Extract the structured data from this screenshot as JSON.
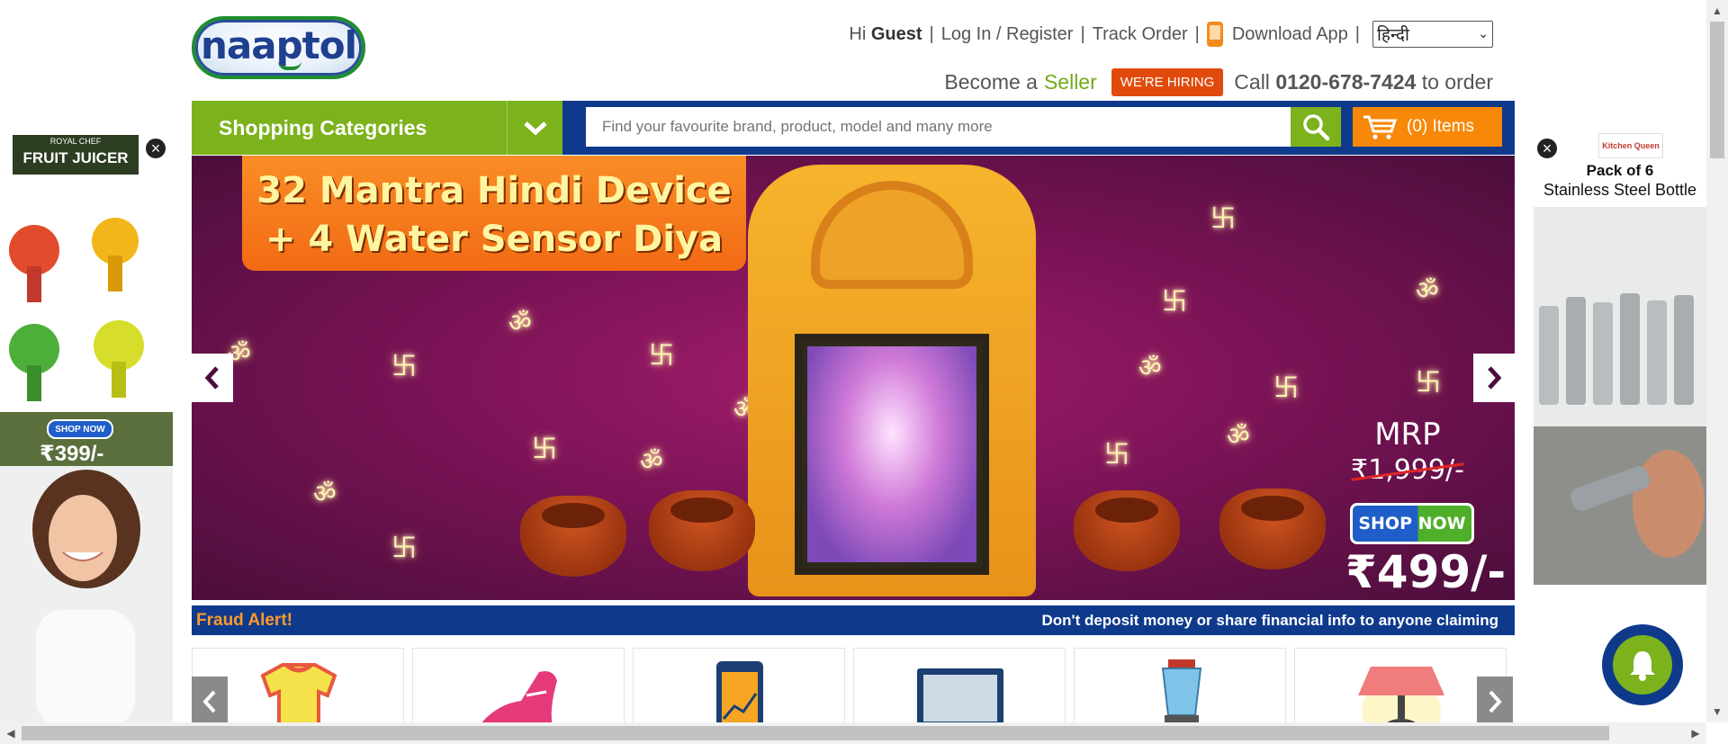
{
  "brand": {
    "logo_text": "naaptol"
  },
  "topnav": {
    "greeting": "Hi",
    "user": "Guest",
    "login": "Log In / Register",
    "track_order": "Track Order",
    "download_app": "Download App",
    "language_selected": "हिन्दी"
  },
  "promo": {
    "become_a": "Become a",
    "seller": "Seller",
    "hiring": "WE'RE HIRING",
    "call_prefix": "Call",
    "phone": "0120-678-7424",
    "call_suffix": "to order"
  },
  "navbar": {
    "categories_label": "Shopping Categories",
    "search_placeholder": "Find your favourite brand, product, model and many more",
    "cart_label": "(0) Items"
  },
  "banner": {
    "title_line1": "32 Mantra Hindi Device",
    "title_line2": "+ 4 Water Sensor Diya",
    "mrp_label": "MRP",
    "mrp_value": "₹1,999/-",
    "shop_now": "SHOP NOW",
    "price": "₹499/-"
  },
  "fraud": {
    "label": "Fraud Alert!",
    "message": "Don't deposit money or share financial info to anyone claiming"
  },
  "categories": [
    {
      "icon": "tshirt-icon"
    },
    {
      "icon": "shoe-icon"
    },
    {
      "icon": "mobile-icon"
    },
    {
      "icon": "laptop-icon"
    },
    {
      "icon": "blender-icon"
    },
    {
      "icon": "lamp-icon"
    }
  ],
  "ad_left": {
    "brand": "ROYAL CHEF",
    "title": "FRUIT JUICER",
    "shop_now": "SHOP NOW",
    "price": "₹399/-"
  },
  "ad_right": {
    "brand": "Kitchen Queen",
    "title_line1": "Pack of 6",
    "title_line2": "Stainless Steel Bottle"
  },
  "colors": {
    "brand_blue": "#0f3a8c",
    "brand_green": "#7cb21c",
    "cart_orange": "#f7880a",
    "hiring_red": "#e04a0c"
  }
}
